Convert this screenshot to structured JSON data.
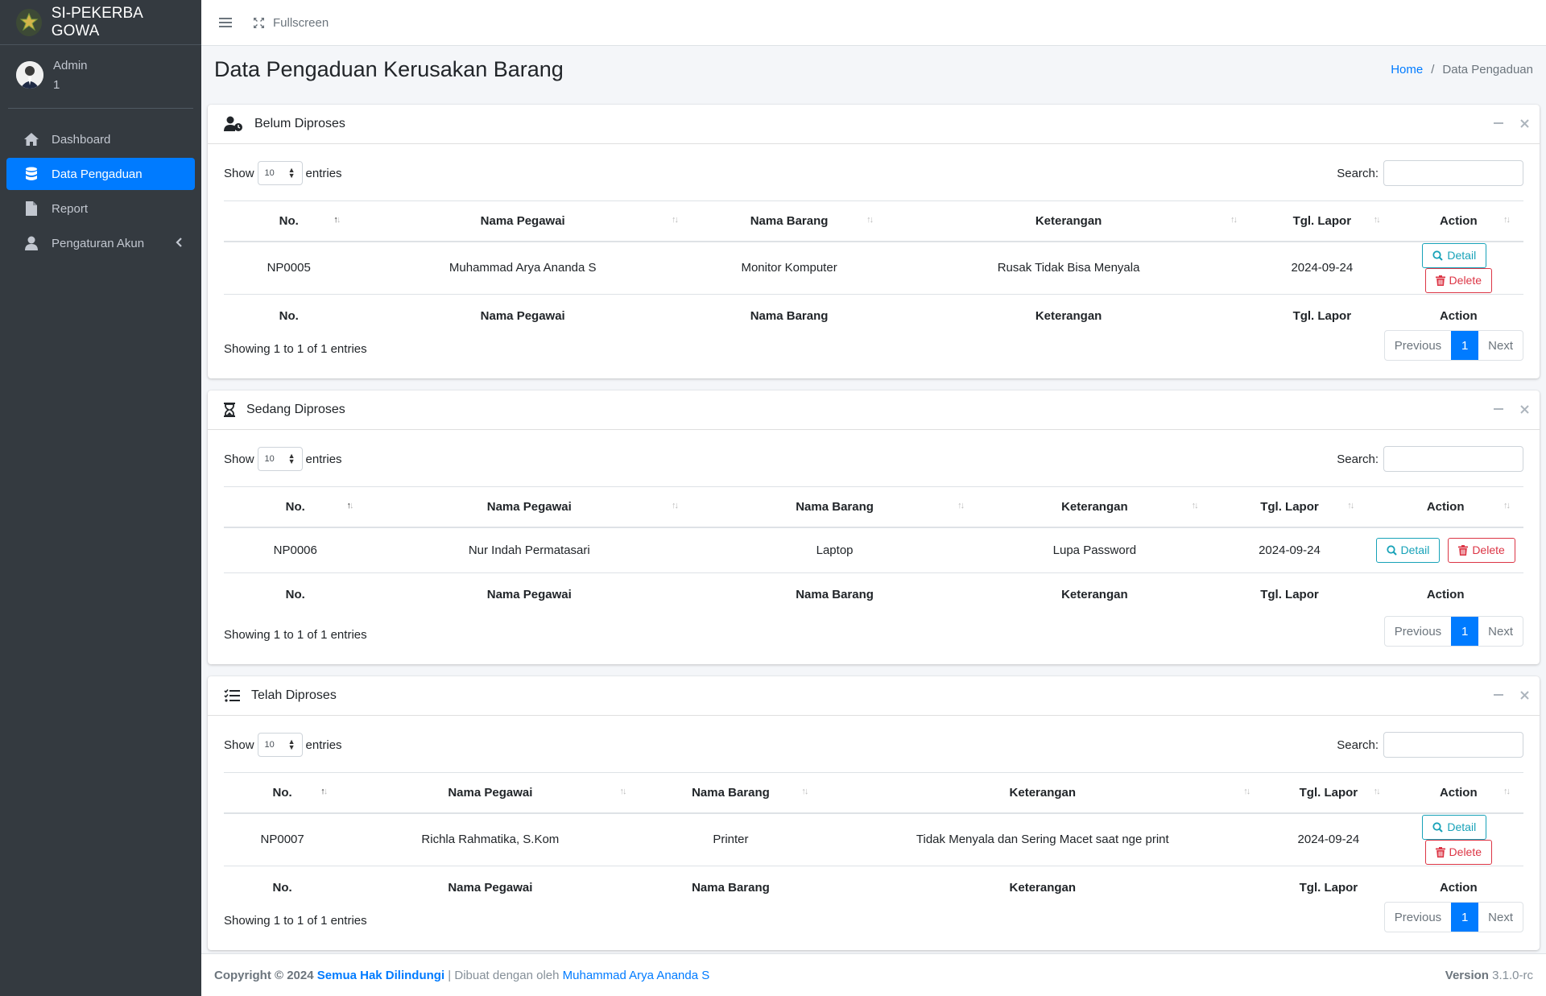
{
  "brand": {
    "name": "SI-PEKERBA GOWA"
  },
  "user": {
    "name": "Admin",
    "id": "1"
  },
  "sidebar": {
    "items": [
      {
        "label": "Dashboard",
        "icon": "home-icon"
      },
      {
        "label": "Data Pengaduan",
        "icon": "database-icon",
        "active": true
      },
      {
        "label": "Report",
        "icon": "file-icon"
      },
      {
        "label": "Pengaturan Akun",
        "icon": "user-icon"
      }
    ]
  },
  "topbar": {
    "fullscreen_label": "Fullscreen"
  },
  "page": {
    "title": "Data Pengaduan Kerusakan Barang",
    "breadcrumb": {
      "home": "Home",
      "sep": "/",
      "current": "Data Pengaduan"
    }
  },
  "common": {
    "show": "Show",
    "entries": "entries",
    "entries_value": "10",
    "search_label": "Search:",
    "detail_label": "Detail",
    "delete_label": "Delete",
    "previous": "Previous",
    "page": "1",
    "next": "Next",
    "info": "Showing 1 to 1 of 1 entries"
  },
  "columns": [
    "No.",
    "Nama Pegawai",
    "Nama Barang",
    "Keterangan",
    "Tgl. Lapor",
    "Action"
  ],
  "cards": [
    {
      "title": "Belum Diproses",
      "icon": "user-clock-icon",
      "row": {
        "no": "NP0005",
        "pegawai": "Muhammad Arya Ananda S",
        "barang": "Monitor Komputer",
        "keterangan": "Rusak Tidak Bisa Menyala",
        "tgl": "2024-09-24"
      }
    },
    {
      "title": "Sedang Diproses",
      "icon": "hourglass-icon",
      "row": {
        "no": "NP0006",
        "pegawai": "Nur Indah Permatasari",
        "barang": "Laptop",
        "keterangan": "Lupa Password",
        "tgl": "2024-09-24"
      }
    },
    {
      "title": "Telah Diproses",
      "icon": "tasks-icon",
      "row": {
        "no": "NP0007",
        "pegawai": "Richla Rahmatika, S.Kom",
        "barang": "Printer",
        "keterangan": "Tidak Menyala dan Sering Macet saat nge print",
        "tgl": "2024-09-24"
      }
    }
  ],
  "footer": {
    "copyright": "Copyright © 2024",
    "rights": "Semua Hak Dilindungi",
    "made_by_prefix": "| Dibuat dengan oleh",
    "author": "Muhammad Arya Ananda S",
    "version_label": "Version",
    "version": "3.1.0-rc"
  },
  "colors": {
    "sidebar": "#343a40",
    "primary": "#007bff",
    "info": "#17a2b8",
    "danger": "#dc3545"
  }
}
